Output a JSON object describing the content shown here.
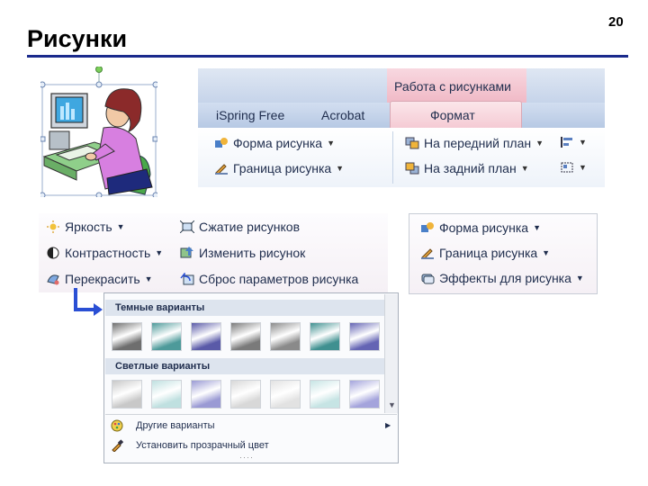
{
  "slide": {
    "title": "Рисунки",
    "number": "20"
  },
  "ribbon": {
    "context_tab": "Работа с рисунками",
    "tabs": [
      "iSpring Free",
      "Acrobat"
    ],
    "active_tab": "Формат",
    "buttons": {
      "shape": "Форма рисунка",
      "border": "Граница рисунка",
      "bring_front": "На передний план",
      "send_back": "На задний план"
    }
  },
  "adjust": {
    "brightness": "Яркость",
    "contrast": "Контрастность",
    "recolor": "Перекрасить",
    "compress": "Сжатие рисунков",
    "change": "Изменить рисунок",
    "reset": "Сброс параметров рисунка"
  },
  "styles": {
    "shape": "Форма рисунка",
    "border": "Граница рисунка",
    "effects": "Эффекты для рисунка"
  },
  "recolor_menu": {
    "dark_header": "Темные варианты",
    "light_header": "Светлые варианты",
    "more_colors": "Другие варианты",
    "set_transparent": "Установить прозрачный цвет",
    "dark_swatches": [
      "#6e6e6e",
      "#4d9a9a",
      "#5a5aa8",
      "#7a7a7a",
      "#8a8a8a",
      "#3f9090",
      "#6464b4"
    ],
    "light_swatches": [
      "#c8c8c8",
      "#bfe0e0",
      "#9a9ad4",
      "#d8d8d8",
      "#e2e2e2",
      "#c6e4e4",
      "#a4a4dc"
    ]
  },
  "colors": {
    "accent_blue": "#1a2a8c",
    "context_pink": "#f0b9c6",
    "arrow_blue": "#2a4fd4"
  }
}
